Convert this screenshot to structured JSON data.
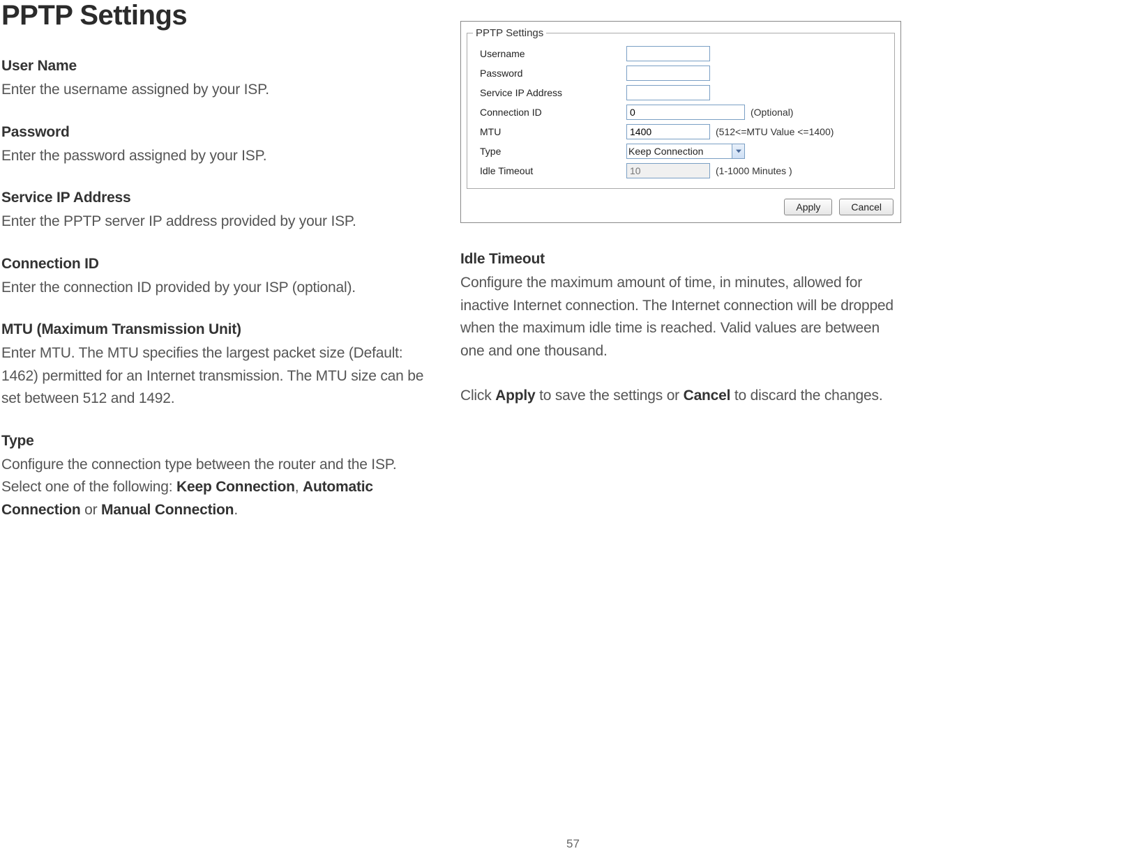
{
  "title": "PPTP Settings",
  "left_fields": [
    {
      "name": "User Name",
      "desc": "Enter the username assigned by your ISP."
    },
    {
      "name": "Password",
      "desc": "Enter the password assigned by your ISP."
    },
    {
      "name": "Service IP Address",
      "desc": "Enter the PPTP server IP address provided by your ISP."
    },
    {
      "name": "Connection ID",
      "desc": "Enter the connection ID provided by your ISP (optional)."
    },
    {
      "name": "MTU (Maximum Transmission Unit)",
      "desc": "Enter MTU. The MTU specifies the largest packet size (Default: 1462) permitted for an Internet transmission. The MTU size can be set between 512 and 1492."
    }
  ],
  "type_field": {
    "name": "Type",
    "desc_pre": "Configure the connection type between the router and the ISP. Select one of the following: ",
    "opt1": "Keep Connection",
    "sep1": ", ",
    "opt2": "Automatic Connection",
    "sep2": " or ",
    "opt3": "Manual Connection",
    "tail": "."
  },
  "right_fields": {
    "idle": {
      "name": "Idle Timeout",
      "desc": "Configure the maximum amount of time, in minutes, allowed for inactive Internet connection. The Internet connection will be dropped when the maximum idle time is reached. Valid values are between one and one thousand."
    },
    "footer_pre": "Click ",
    "footer_apply": "Apply",
    "footer_mid": " to save the settings or ",
    "footer_cancel": "Cancel",
    "footer_tail": " to discard the changes."
  },
  "panel": {
    "legend": "PPTP Settings",
    "rows": {
      "username": {
        "label": "Username",
        "value": ""
      },
      "password": {
        "label": "Password",
        "value": ""
      },
      "service_ip": {
        "label": "Service IP Address",
        "value": ""
      },
      "conn_id": {
        "label": "Connection ID",
        "value": "0",
        "hint": "(Optional)"
      },
      "mtu": {
        "label": "MTU",
        "value": "1400",
        "hint": "(512<=MTU Value <=1400)"
      },
      "type": {
        "label": "Type",
        "value": "Keep Connection"
      },
      "idle": {
        "label": "Idle Timeout",
        "value": "10",
        "hint": "(1-1000 Minutes )"
      }
    },
    "buttons": {
      "apply": "Apply",
      "cancel": "Cancel"
    }
  },
  "page_number": "57"
}
